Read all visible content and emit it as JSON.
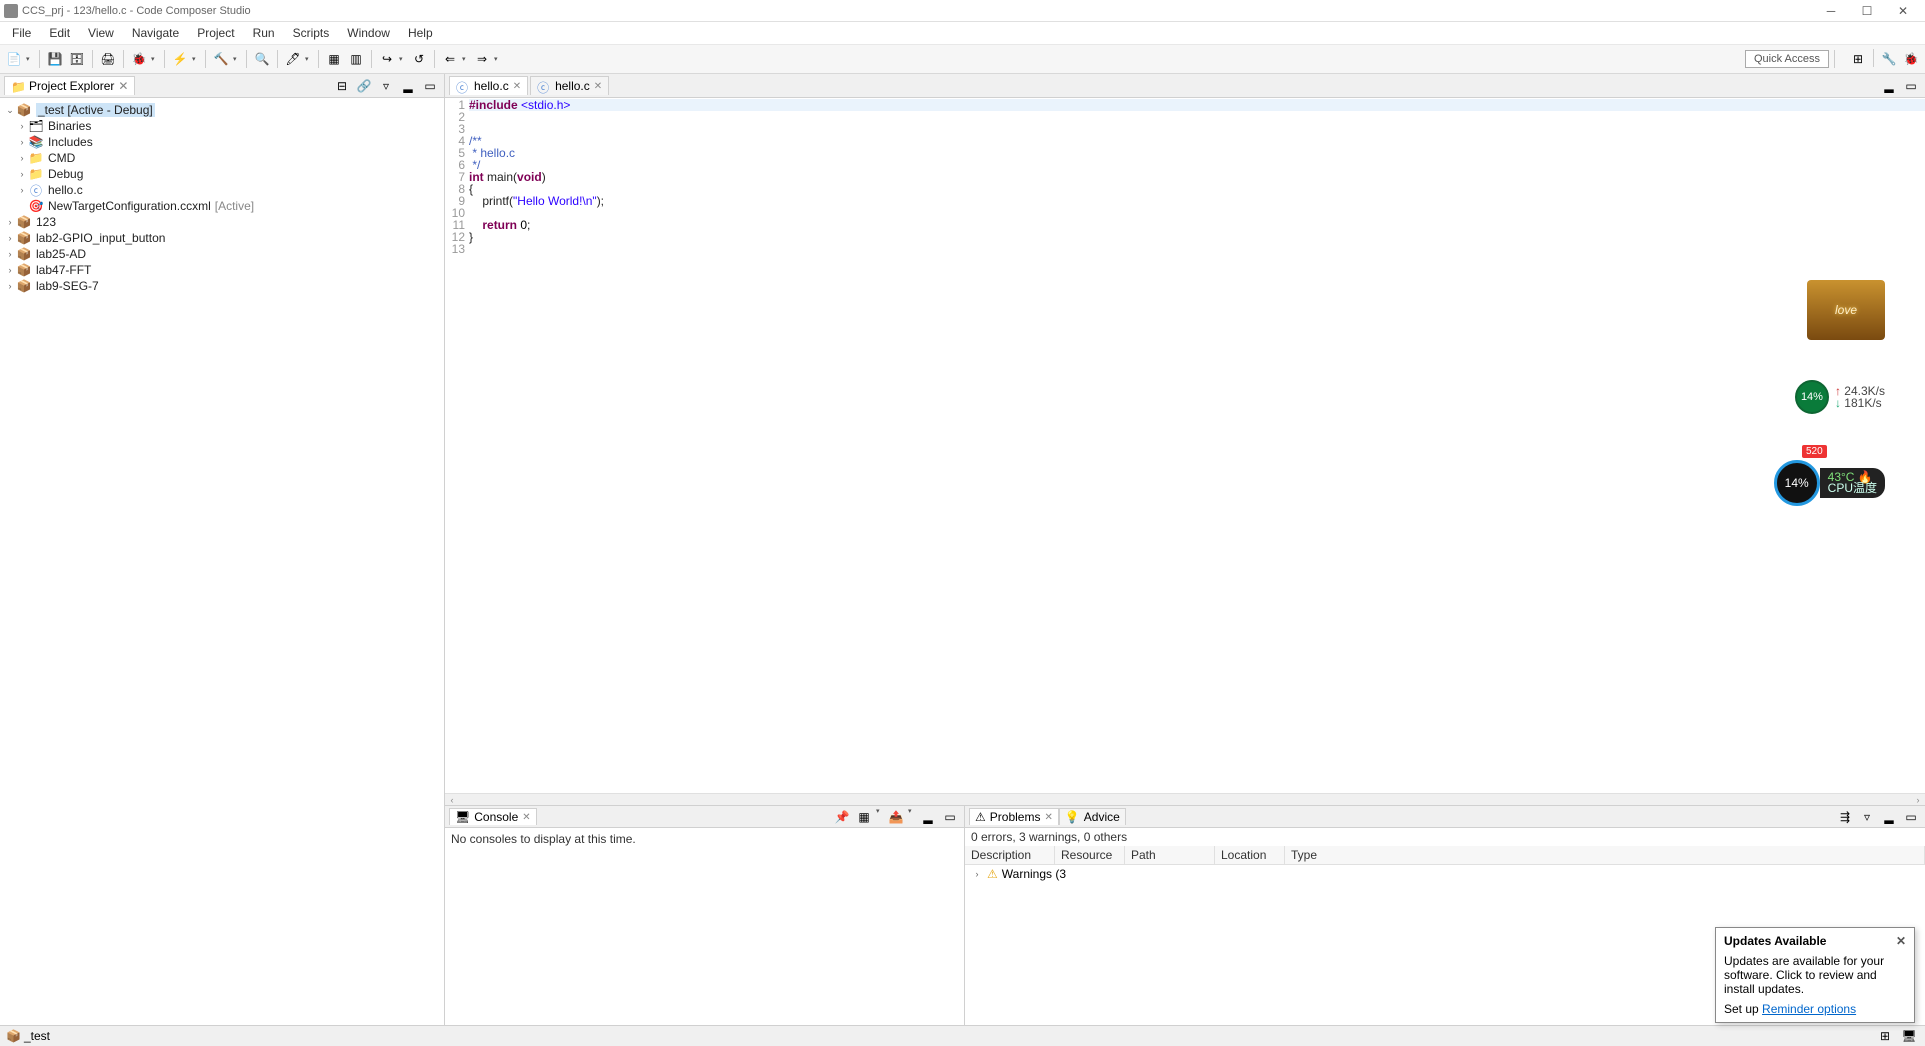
{
  "title": "CCS_prj - 123/hello.c - Code Composer Studio",
  "menus": [
    "File",
    "Edit",
    "View",
    "Navigate",
    "Project",
    "Run",
    "Scripts",
    "Window",
    "Help"
  ],
  "quick_access": "Quick Access",
  "explorer": {
    "title": "Project Explorer",
    "active_project": "_test  [Active - Debug]",
    "children": [
      {
        "label": "Binaries",
        "icon": "binaries"
      },
      {
        "label": "Includes",
        "icon": "includes"
      },
      {
        "label": "CMD",
        "icon": "folder"
      },
      {
        "label": "Debug",
        "icon": "folder"
      },
      {
        "label": "hello.c",
        "icon": "c"
      },
      {
        "label": "NewTargetConfiguration.ccxml",
        "icon": "target",
        "suffix": "[Active]"
      }
    ],
    "siblings": [
      {
        "label": "123",
        "icon": "proj-closed"
      },
      {
        "label": "lab2-GPIO_input_button",
        "icon": "proj"
      },
      {
        "label": "lab25-AD",
        "icon": "proj"
      },
      {
        "label": "lab47-FFT",
        "icon": "proj"
      },
      {
        "label": "lab9-SEG-7",
        "icon": "proj"
      }
    ]
  },
  "editor": {
    "tabs": [
      {
        "label": "hello.c",
        "active": true
      },
      {
        "label": "hello.c",
        "active": false
      }
    ],
    "lines": [
      {
        "n": 1,
        "html": "<span class='kw'>#include</span> <span class='str'>&lt;stdio.h&gt;</span>",
        "highlight": true
      },
      {
        "n": 2,
        "html": ""
      },
      {
        "n": 3,
        "html": ""
      },
      {
        "n": 4,
        "html": "<span class='cm'>/**</span>"
      },
      {
        "n": 5,
        "html": "<span class='cm'> * hello.c</span>"
      },
      {
        "n": 6,
        "html": "<span class='cm'> */</span>"
      },
      {
        "n": 7,
        "html": "<span class='kw'>int</span> main(<span class='kw'>void</span>)"
      },
      {
        "n": 8,
        "html": "{"
      },
      {
        "n": 9,
        "html": "    printf(<span class='str'>\"Hello World!\\n\"</span>);"
      },
      {
        "n": 10,
        "html": ""
      },
      {
        "n": 11,
        "html": "    <span class='kw'>return</span> <span class='num'>0</span>;"
      },
      {
        "n": 12,
        "html": "}"
      },
      {
        "n": 13,
        "html": ""
      }
    ]
  },
  "console": {
    "title": "Console",
    "body": "No consoles to display at this time."
  },
  "problems": {
    "title": "Problems",
    "advice": "Advice",
    "summary": "0 errors, 3 warnings, 0 others",
    "columns": [
      "Description",
      "Resource",
      "Path",
      "Location",
      "Type"
    ],
    "row": "Warnings (3"
  },
  "updates": {
    "title": "Updates Available",
    "body1": "Updates are available for your software. Click to review and install updates.",
    "body2": "Set up ",
    "link": "Reminder options"
  },
  "status": {
    "left": "_test"
  },
  "widgets": {
    "love": "love",
    "net_pct": "14%",
    "net_up": "24.3K/s",
    "net_down": "181K/s",
    "cpu_pct": "14%",
    "cpu_gift": "520",
    "cpu_temp": "43°C",
    "cpu_label": "CPU温度"
  }
}
